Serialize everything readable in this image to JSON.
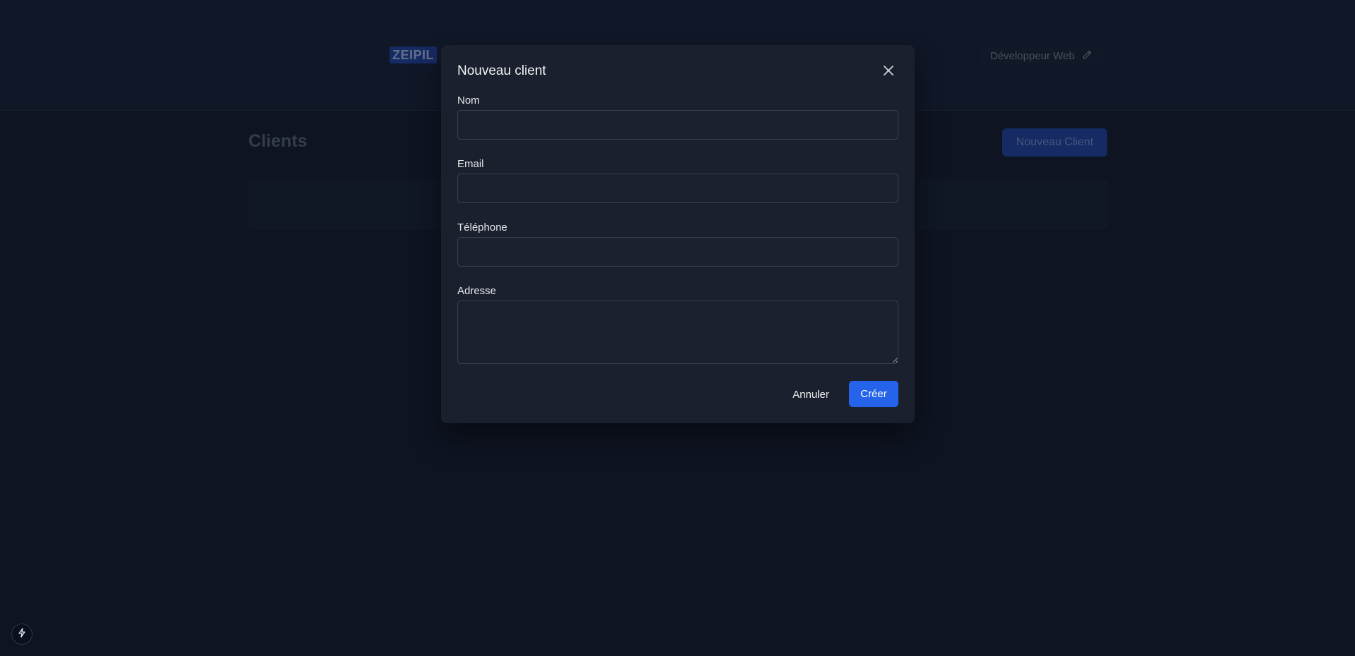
{
  "header": {
    "logo_text": "ZEIPIL",
    "user_label": "Développeur Web",
    "user_icon": "pencil-icon"
  },
  "page": {
    "title": "Clients",
    "new_client_label": "Nouveau Client"
  },
  "modal": {
    "title": "Nouveau client",
    "close_icon": "close-icon",
    "fields": {
      "nom": {
        "label": "Nom",
        "value": ""
      },
      "email": {
        "label": "Email",
        "value": ""
      },
      "telephone": {
        "label": "Téléphone",
        "value": ""
      },
      "adresse": {
        "label": "Adresse",
        "value": ""
      }
    },
    "cancel_label": "Annuler",
    "create_label": "Créer"
  },
  "colors": {
    "background": "#111827",
    "modal_bg": "#1a202d",
    "accent": "#2563eb"
  },
  "dev_badge_icon": "lightning-icon"
}
